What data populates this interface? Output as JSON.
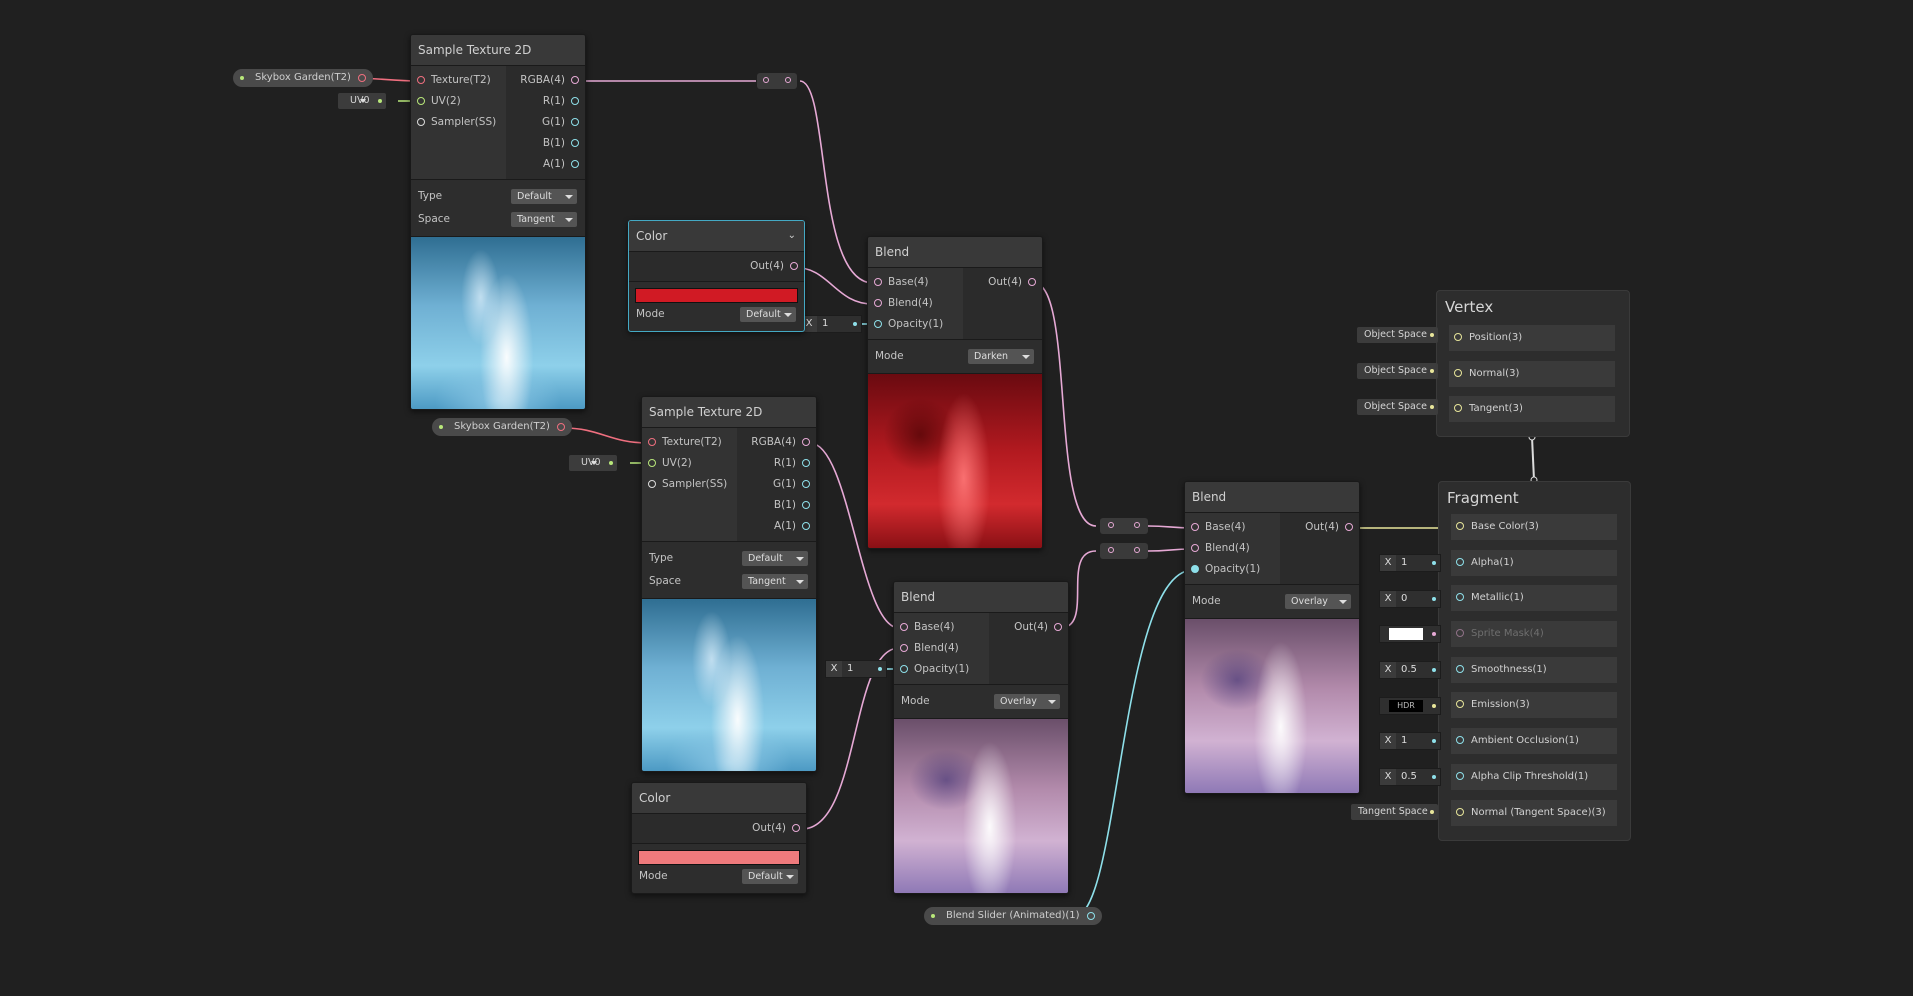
{
  "nodes": {
    "tex1": {
      "title": "Sample Texture 2D",
      "inputs": [
        "Texture(T2)",
        "UV(2)",
        "Sampler(SS)"
      ],
      "outputs": [
        "RGBA(4)",
        "R(1)",
        "G(1)",
        "B(1)",
        "A(1)"
      ],
      "type_label": "Type",
      "type_value": "Default",
      "space_label": "Space",
      "space_value": "Tangent"
    },
    "tex2": {
      "title": "Sample Texture 2D",
      "inputs": [
        "Texture(T2)",
        "UV(2)",
        "Sampler(SS)"
      ],
      "outputs": [
        "RGBA(4)",
        "R(1)",
        "G(1)",
        "B(1)",
        "A(1)"
      ],
      "type_label": "Type",
      "type_value": "Default",
      "space_label": "Space",
      "space_value": "Tangent"
    },
    "color1": {
      "title": "Color",
      "output": "Out(4)",
      "mode_label": "Mode",
      "mode_value": "Default",
      "swatch": "#d11a24"
    },
    "color2": {
      "title": "Color",
      "output": "Out(4)",
      "mode_label": "Mode",
      "mode_value": "Default",
      "swatch": "#ef7a7c"
    },
    "blend1": {
      "title": "Blend",
      "inputs": [
        "Base(4)",
        "Blend(4)",
        "Opacity(1)"
      ],
      "output": "Out(4)",
      "mode_label": "Mode",
      "mode_value": "Darken"
    },
    "blend2": {
      "title": "Blend",
      "inputs": [
        "Base(4)",
        "Blend(4)",
        "Opacity(1)"
      ],
      "output": "Out(4)",
      "mode_label": "Mode",
      "mode_value": "Overlay"
    },
    "blend3": {
      "title": "Blend",
      "inputs": [
        "Base(4)",
        "Blend(4)",
        "Opacity(1)"
      ],
      "output": "Out(4)",
      "mode_label": "Mode",
      "mode_value": "Overlay"
    }
  },
  "properties": {
    "sky1": "Skybox Garden(T2)",
    "sky2": "Skybox Garden(T2)",
    "slider": "Blend Slider (Animated)(1)"
  },
  "uv": {
    "uv1": "UV0",
    "uv2": "UV0"
  },
  "opacity_inputs": {
    "o1": {
      "x": "X",
      "v": "1"
    },
    "o2": {
      "x": "X",
      "v": "1"
    }
  },
  "vertex": {
    "title": "Vertex",
    "rows": [
      {
        "label": "Position(3)",
        "source": "Object Space"
      },
      {
        "label": "Normal(3)",
        "source": "Object Space"
      },
      {
        "label": "Tangent(3)",
        "source": "Object Space"
      }
    ]
  },
  "fragment": {
    "title": "Fragment",
    "rows": [
      {
        "label": "Base Color(3)"
      },
      {
        "label": "Alpha(1)",
        "x": "X",
        "v": "1"
      },
      {
        "label": "Metallic(1)",
        "x": "X",
        "v": "0"
      },
      {
        "label": "Sprite Mask(4)"
      },
      {
        "label": "Smoothness(1)",
        "x": "X",
        "v": "0.5"
      },
      {
        "label": "Emission(3)",
        "hdr": "HDR"
      },
      {
        "label": "Ambient Occlusion(1)",
        "x": "X",
        "v": "1"
      },
      {
        "label": "Alpha Clip Threshold(1)",
        "x": "X",
        "v": "0.5"
      },
      {
        "label": "Normal (Tangent Space)(3)",
        "source": "Tangent Space"
      }
    ]
  },
  "colors": {
    "background": "#202020",
    "wire_color": "#e6a9d5",
    "wire_float": "#8ee0ea",
    "wire_vec3": "#e7e59a",
    "selection": "#44a9c4"
  }
}
